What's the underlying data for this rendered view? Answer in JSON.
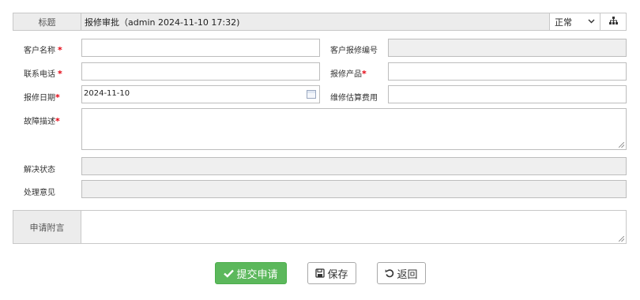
{
  "title_row": {
    "label": "标题",
    "value": "报修审批（admin 2024-11-10 17:32)",
    "status_selected": "正常",
    "org_icon": "sitemap-icon"
  },
  "fields": {
    "customer_name": {
      "label": "客户名称",
      "required": "*",
      "value": ""
    },
    "customer_repair_no": {
      "label": "客户报修编号",
      "value": ""
    },
    "phone": {
      "label": "联系电话",
      "required": "*",
      "value": ""
    },
    "product": {
      "label": "报修产品",
      "required": "*",
      "value": ""
    },
    "repair_date": {
      "label": "报修日期",
      "required": "*",
      "value": "2024-11-10"
    },
    "estimated_cost": {
      "label": "维修估算费用",
      "value": ""
    },
    "fault_desc": {
      "label": "故障描述",
      "required": "*",
      "value": ""
    },
    "resolve_status": {
      "label": "解决状态",
      "value": ""
    },
    "opinion": {
      "label": "处理意见",
      "value": ""
    }
  },
  "remark": {
    "label": "申请附言",
    "value": ""
  },
  "buttons": {
    "submit": "提交申请",
    "save": "保存",
    "back": "返回"
  },
  "colors": {
    "submit_bg": "#5cb85c",
    "required": "#e4000f",
    "label_bg": "#ececec",
    "readonly_bg": "#efefef"
  }
}
